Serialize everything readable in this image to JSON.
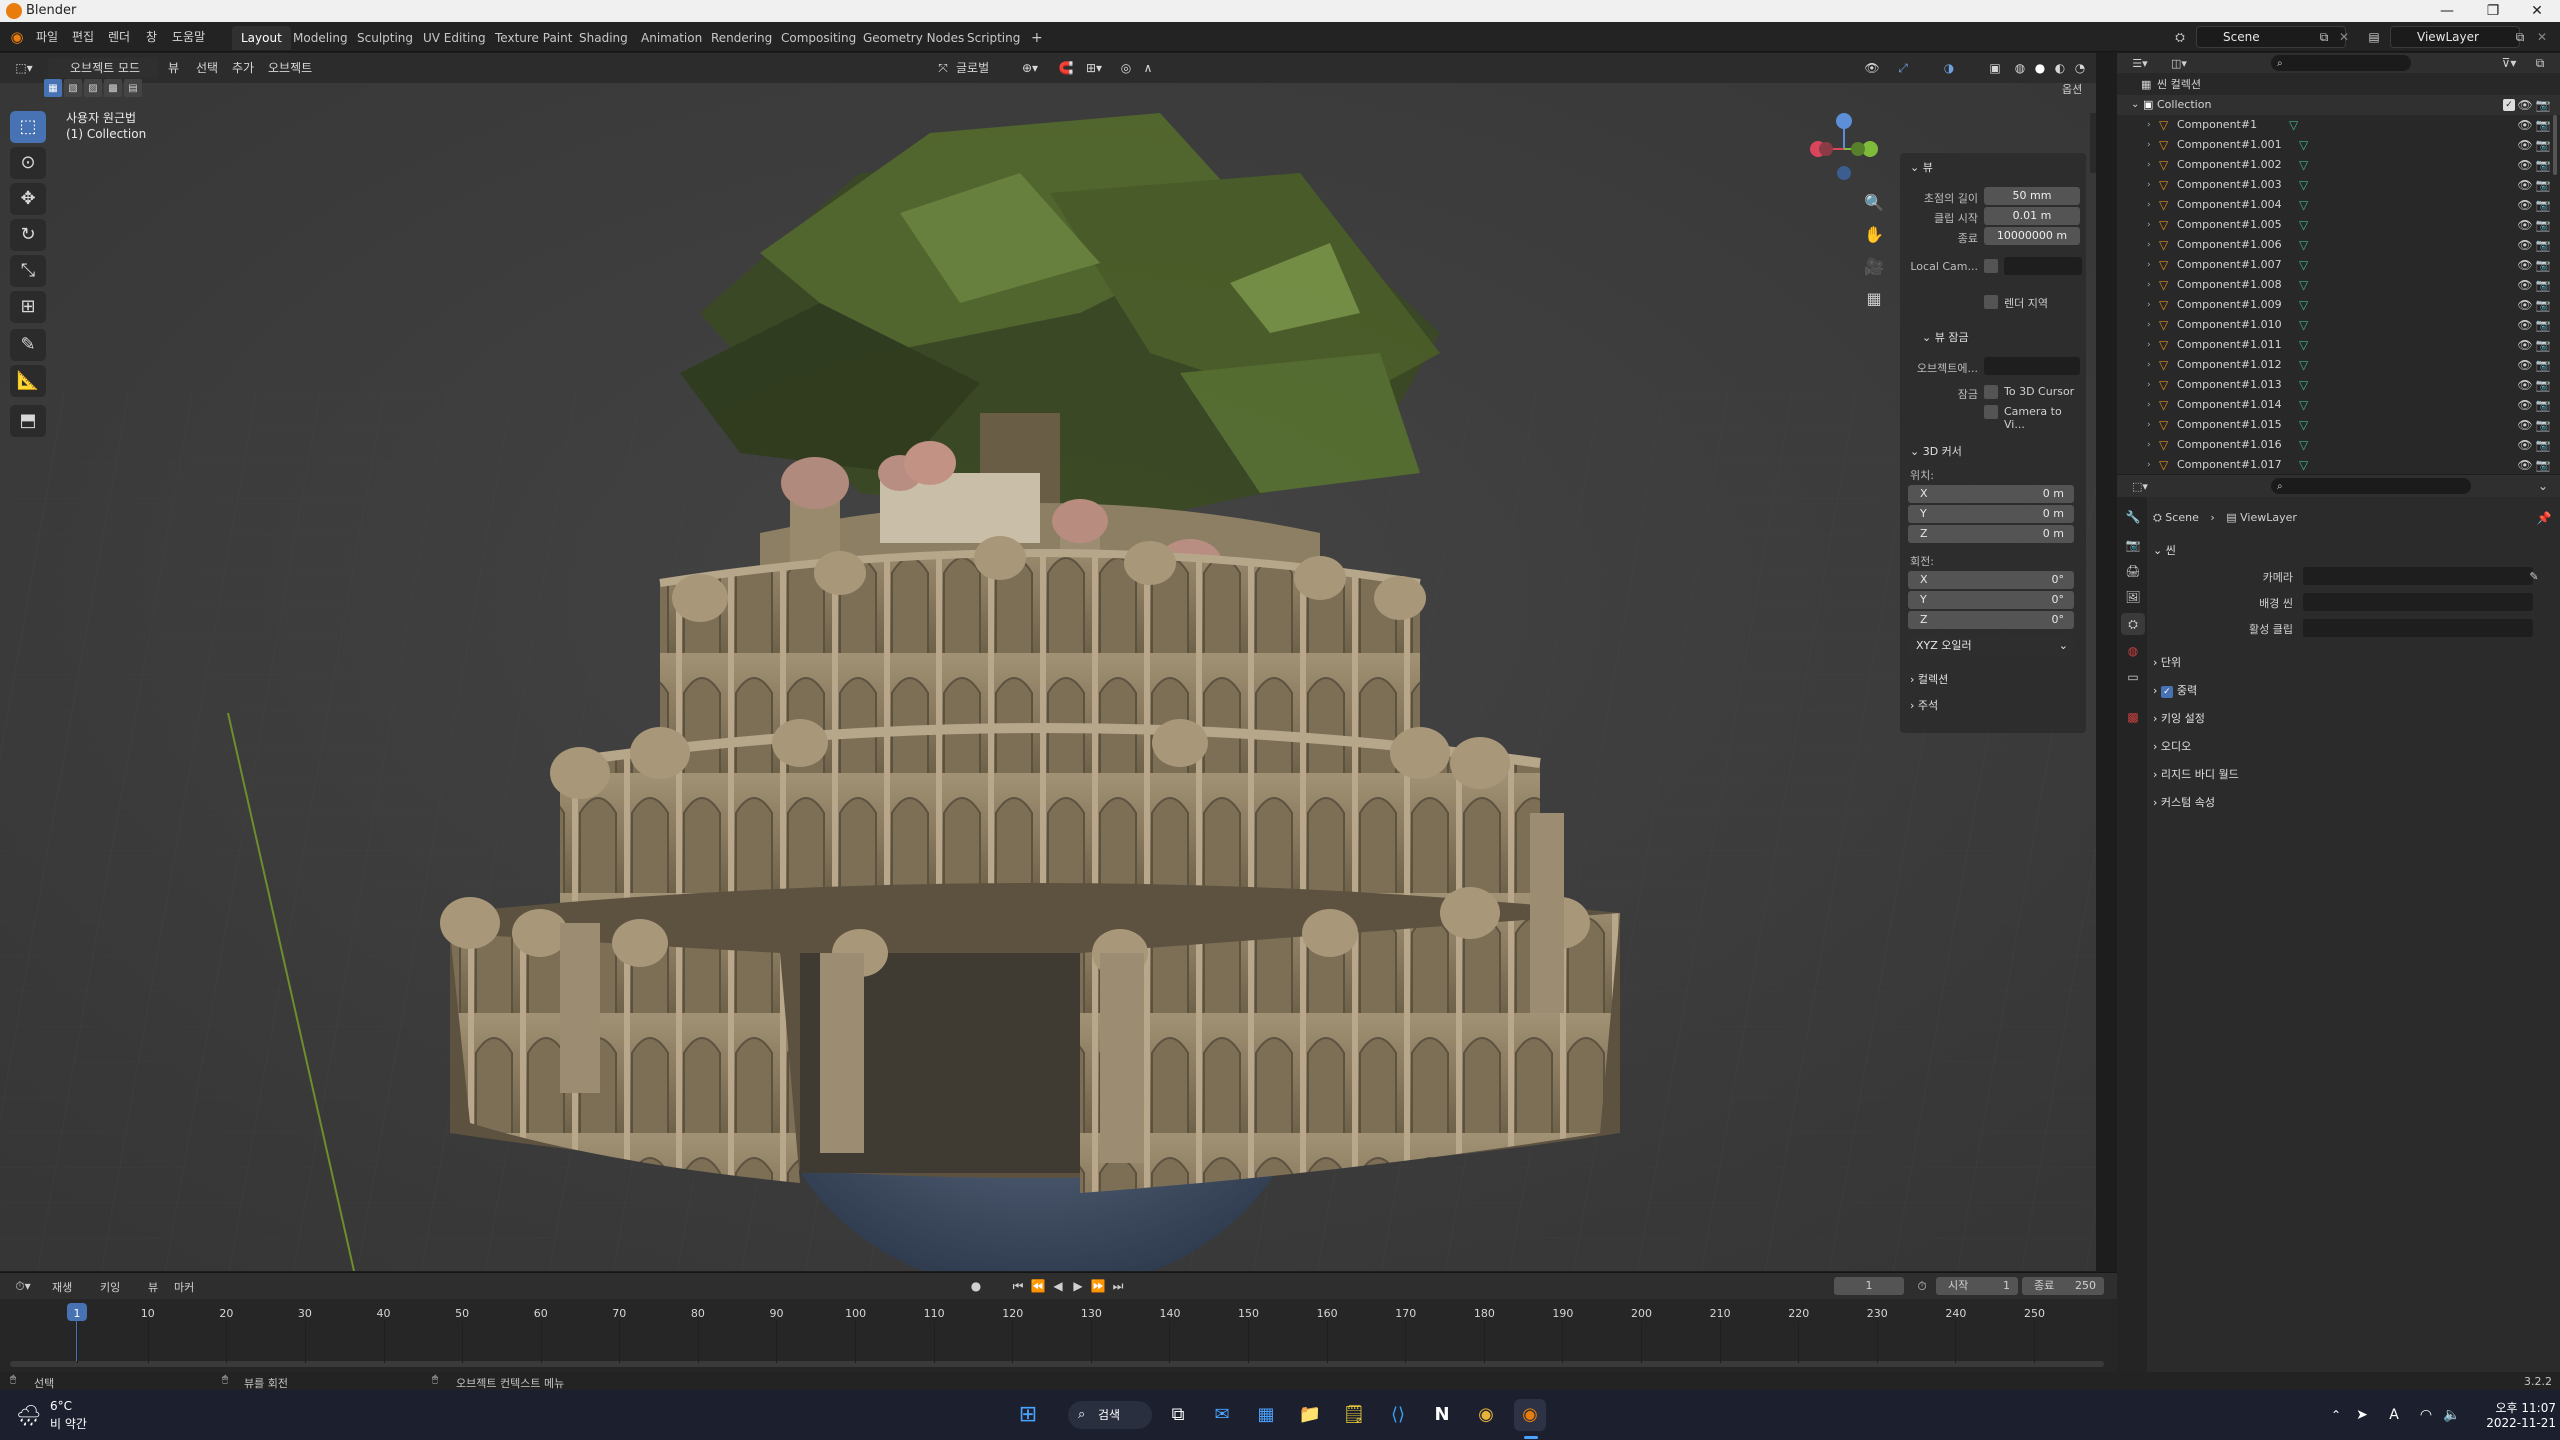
{
  "window": {
    "title": "Blender"
  },
  "menu": [
    "파일",
    "편집",
    "렌더",
    "창",
    "도움말"
  ],
  "workspaces": {
    "active": "Layout",
    "tabs": [
      "Layout",
      "Modeling",
      "Sculpting",
      "UV Editing",
      "Texture Paint",
      "Shading",
      "Animation",
      "Rendering",
      "Compositing",
      "Geometry Nodes",
      "Scripting"
    ],
    "add": "+"
  },
  "scene": {
    "name": "Scene",
    "view_layer": "ViewLayer"
  },
  "viewport": {
    "mode": "오브젝트 모드",
    "menus": [
      "뷰",
      "선택",
      "추가",
      "오브젝트"
    ],
    "orientation": "글로벌",
    "options": "옵션",
    "info_line1": "사용자 원근법",
    "info_line2": "(1) Collection"
  },
  "npanel": {
    "view_header": "뷰",
    "focal_label": "초점의 길이",
    "focal_value": "50 mm",
    "clip_start_label": "클립 시작",
    "clip_start_value": "0.01 m",
    "clip_end_label": "종료",
    "clip_end_value": "10000000 m",
    "local_cam": "Local Cam...",
    "render_region": "렌더 지역",
    "view_lock_header": "뷰 잠금",
    "lock_object_label": "오브젝트에...",
    "lock_label": "잠금",
    "to_3d_cursor": "To 3D Cursor",
    "camera_to_view": "Camera to Vi...",
    "cursor_header": "3D 커서",
    "location_label": "위치:",
    "loc": [
      {
        "axis": "X",
        "value": "0 m"
      },
      {
        "axis": "Y",
        "value": "0 m"
      },
      {
        "axis": "Z",
        "value": "0 m"
      }
    ],
    "rotation_label": "회전:",
    "rot": [
      {
        "axis": "X",
        "value": "0°"
      },
      {
        "axis": "Y",
        "value": "0°"
      },
      {
        "axis": "Z",
        "value": "0°"
      }
    ],
    "rotation_mode": "XYZ 오일러",
    "collection_header": "컬렉션",
    "annotation_header": "주석"
  },
  "outliner": {
    "root": "씬 컬렉션",
    "collection": "Collection",
    "items": [
      "Component#1",
      "Component#1.001",
      "Component#1.002",
      "Component#1.003",
      "Component#1.004",
      "Component#1.005",
      "Component#1.006",
      "Component#1.007",
      "Component#1.008",
      "Component#1.009",
      "Component#1.010",
      "Component#1.011",
      "Component#1.012",
      "Component#1.013",
      "Component#1.014",
      "Component#1.015",
      "Component#1.016",
      "Component#1.017"
    ]
  },
  "properties": {
    "breadcrumb_scene": "Scene",
    "breadcrumb_layer": "ViewLayer",
    "section_scene": "씬",
    "camera_label": "카메라",
    "background_scene_label": "배경 씬",
    "active_clip_label": "활성 클립",
    "sections": [
      "단위",
      "중력",
      "키잉 설정",
      "오디오",
      "리지드 바디 월드",
      "커스텀 속성"
    ]
  },
  "timeline": {
    "menus": [
      "재생",
      "키잉",
      "뷰",
      "마커"
    ],
    "current_frame": "1",
    "start_label": "시작",
    "start_value": "1",
    "end_label": "종료",
    "end_value": "250",
    "ticks": [
      "1",
      "10",
      "20",
      "30",
      "40",
      "50",
      "60",
      "70",
      "80",
      "90",
      "100",
      "110",
      "120",
      "130",
      "140",
      "150",
      "160",
      "170",
      "180",
      "190",
      "200",
      "210",
      "220",
      "230",
      "240",
      "250"
    ]
  },
  "status": {
    "select": "선택",
    "rotate": "뷰를 회전",
    "context": "오브젝트 컨텍스트 메뉴",
    "version": "3.2.2"
  },
  "taskbar": {
    "weather_temp": "6°C",
    "weather_desc": "비 약간",
    "search": "검색",
    "time": "오후 11:07",
    "date": "2022-11-21",
    "ime": "A"
  },
  "colors": {
    "accent": "#4772b3",
    "orange": "#e87d0d",
    "teal": "#3fb98a"
  }
}
